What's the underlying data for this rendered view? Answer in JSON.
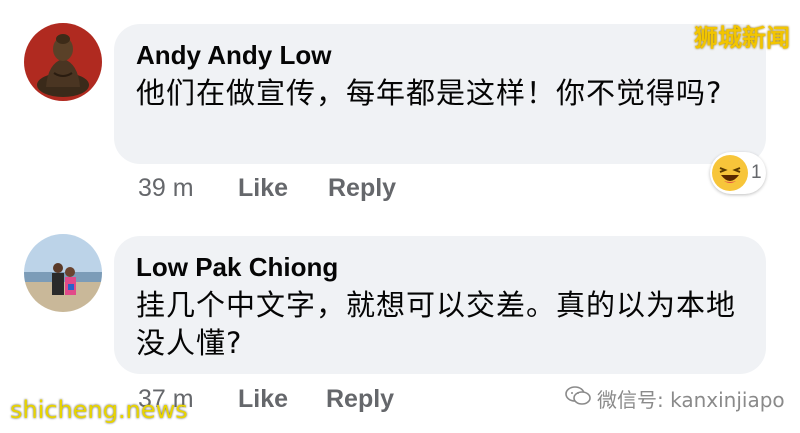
{
  "watermark_top": "狮城新闻",
  "watermark_bottom": "shicheng.news",
  "wechat_label": "微信号: kanxinjiapo",
  "comments": [
    {
      "author": "Andy Andy Low",
      "text": "他们在做宣传，每年都是这样！你不觉得吗?",
      "time": "39 m",
      "like_label": "Like",
      "reply_label": "Reply",
      "reaction": {
        "icon": "laughing-emoji-icon",
        "count": "1"
      }
    },
    {
      "author": "Low Pak Chiong",
      "text": "挂几个中文字，就想可以交差。真的以为本地没人懂?",
      "time": "37 m",
      "like_label": "Like",
      "reply_label": "Reply"
    }
  ]
}
